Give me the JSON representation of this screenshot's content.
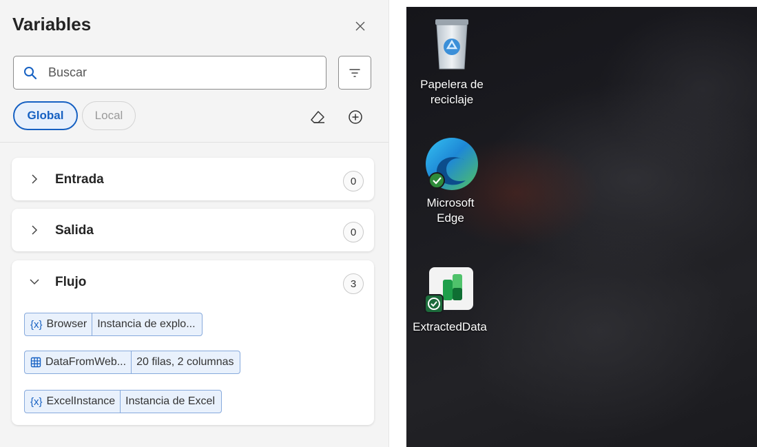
{
  "panel": {
    "title": "Variables",
    "close_icon": "close-icon",
    "search": {
      "placeholder": "Buscar",
      "icon": "search-icon"
    },
    "filter_icon": "filter-icon",
    "scopes": [
      {
        "label": "Global",
        "selected": true
      },
      {
        "label": "Local",
        "selected": false
      }
    ],
    "tools": {
      "clear_icon": "eraser-icon",
      "add_icon": "add-circle-icon"
    },
    "sections": [
      {
        "label": "Entrada",
        "count": "0",
        "expanded": false
      },
      {
        "label": "Salida",
        "count": "0",
        "expanded": false
      },
      {
        "label": "Flujo",
        "count": "3",
        "expanded": true,
        "variables": [
          {
            "icon": "{x}",
            "name": "Browser",
            "value": "Instancia de explo..."
          },
          {
            "icon": "table-icon",
            "name": "DataFromWeb...",
            "value": "20 filas, 2 columnas"
          },
          {
            "icon": "{x}",
            "name": "ExcelInstance",
            "value": "Instancia de Excel"
          }
        ]
      }
    ],
    "accent_color": "#1560c2"
  },
  "desktop": {
    "icons": [
      {
        "name": "Papelera de reciclaje",
        "icon": "recycle-bin-icon"
      },
      {
        "name": "Microsoft Edge",
        "icon": "edge-icon"
      },
      {
        "name": "ExtractedData",
        "icon": "excel-file-icon"
      }
    ]
  }
}
